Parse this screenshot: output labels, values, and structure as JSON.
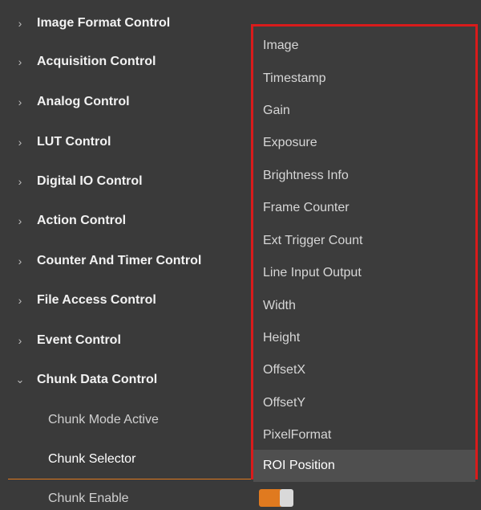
{
  "tree": {
    "items": [
      {
        "label": "Image Format Control",
        "expanded": false
      },
      {
        "label": "Acquisition Control",
        "expanded": false
      },
      {
        "label": "Analog Control",
        "expanded": false
      },
      {
        "label": "LUT Control",
        "expanded": false
      },
      {
        "label": "Digital IO Control",
        "expanded": false
      },
      {
        "label": "Action Control",
        "expanded": false
      },
      {
        "label": "Counter And Timer Control",
        "expanded": false
      },
      {
        "label": "File Access Control",
        "expanded": false
      },
      {
        "label": "Event Control",
        "expanded": false
      },
      {
        "label": "Chunk Data Control",
        "expanded": true
      }
    ],
    "children": [
      {
        "label": "Chunk Mode Active"
      },
      {
        "label": "Chunk Selector"
      },
      {
        "label": "Chunk Enable"
      }
    ],
    "collapsed_icon": "chevron-right-icon",
    "expanded_icon": "chevron-down-icon"
  },
  "chunk_enable_toggle": {
    "state": "on",
    "accent_color": "#e07a1f"
  },
  "chunk_selector_dropdown": {
    "options": [
      "Image",
      "Timestamp",
      "Gain",
      "Exposure",
      "Brightness Info",
      "Frame Counter",
      "Ext Trigger Count",
      "Line Input Output",
      "Width",
      "Height",
      "OffsetX",
      "OffsetY",
      "PixelFormat",
      "ROI Position"
    ],
    "selected": "ROI Position",
    "highlight_border_color": "#d91b1b"
  }
}
